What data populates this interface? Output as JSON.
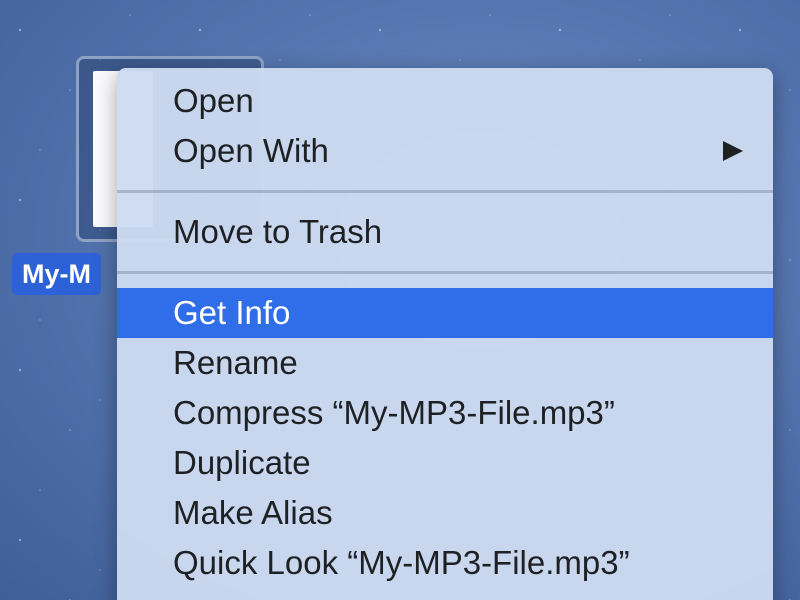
{
  "desktop": {
    "file": {
      "label": "My-M"
    }
  },
  "menu": {
    "open": "Open",
    "open_with": "Open With",
    "move_to_trash": "Move to Trash",
    "get_info": "Get Info",
    "rename": "Rename",
    "compress": "Compress “My-MP3-File.mp3”",
    "duplicate": "Duplicate",
    "make_alias": "Make Alias",
    "quick_look": "Quick Look “My-MP3-File.mp3”",
    "highlighted_item": "Get Info",
    "submenu_icon": "triangle-right-icon"
  },
  "colors": {
    "highlight": "#2f6ee8",
    "menu_background": "#cddbf0",
    "file_label_background": "#2d62d6"
  }
}
